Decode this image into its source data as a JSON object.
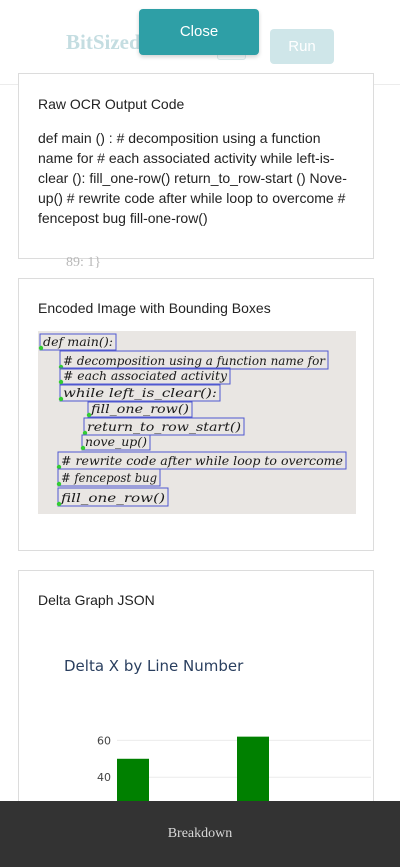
{
  "header": {
    "brand": "BitSized",
    "run_label": "Run"
  },
  "modal": {
    "close_label": "Close"
  },
  "ocr_card": {
    "title": "Raw OCR Output Code",
    "text": "def main () : # decomposition using a function name for # each associated activity while left-is-clear (): fill_one-row() return_to_row-start () Nove-up() # rewrite code after while loop to overcome # fencepost bug fill-one-row()"
  },
  "background_code": "89: 1}",
  "image_card": {
    "title": "Encoded Image with Bounding Boxes",
    "lines": [
      "def main():",
      "# decomposition using a function name for",
      "# each associated activity",
      "while left_is_clear():",
      "fill_one_row()",
      "return_to_row_start()",
      "nove_up()",
      "# rewrite code after while loop to overcome",
      "# fencepost bug",
      "fill_one_row()"
    ],
    "colors": {
      "box": "#5058d0",
      "start_marker": "#33cc33",
      "ink": "#1a1a1a",
      "paper": "#e9e6e3"
    }
  },
  "delta_card": {
    "title": "Delta Graph JSON",
    "chart_data": {
      "type": "bar",
      "title": "Delta X by Line Number",
      "xlabel": "",
      "ylabel": "",
      "visible_y_ticks": [
        "40",
        "60"
      ],
      "series": [
        {
          "values": [
            50,
            62
          ]
        }
      ],
      "bar_color": "#008000",
      "grid": true
    }
  },
  "footer": {
    "label": "Breakdown"
  }
}
